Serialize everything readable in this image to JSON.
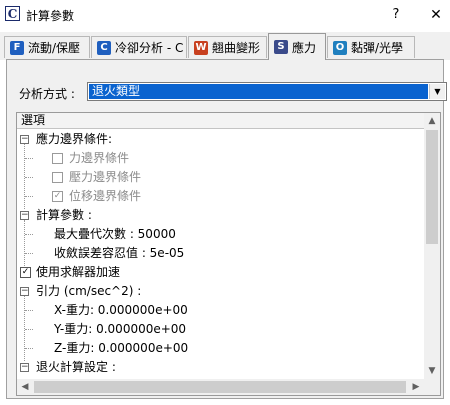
{
  "window": {
    "title": "計算參數",
    "app_icon": "C",
    "help": "?",
    "close": "✕"
  },
  "tabs": [
    {
      "icon": "F",
      "icon_color": "#1f5fbf",
      "label": "流動/保壓",
      "active": false
    },
    {
      "icon": "C",
      "icon_color": "#1f5fbf",
      "label": "冷卻分析 - C",
      "active": false
    },
    {
      "icon": "W",
      "icon_color": "#c8401f",
      "label": "翹曲變形",
      "active": false
    },
    {
      "icon": "S",
      "icon_color": "#3a4a8a",
      "label": "應力",
      "active": true
    },
    {
      "icon": "O",
      "icon_color": "#1f7fbf",
      "label": "黏彈/光學",
      "active": false
    }
  ],
  "method": {
    "label": "分析方式 :",
    "value": "退火類型",
    "arrow": "▼"
  },
  "tree": {
    "header": "選項",
    "rows": [
      {
        "type": "group",
        "expander": "−",
        "text": "應力邊界條件:"
      },
      {
        "type": "checkbox",
        "checked": false,
        "disabled": true,
        "text": "力邊界條件"
      },
      {
        "type": "checkbox",
        "checked": false,
        "disabled": true,
        "text": "壓力邊界條件"
      },
      {
        "type": "checkbox",
        "checked": true,
        "disabled": false,
        "text": "位移邊界條件"
      },
      {
        "type": "group",
        "expander": "−",
        "text": "計算參數 :"
      },
      {
        "type": "value",
        "text": "最大疊代次數 : 50000"
      },
      {
        "type": "value",
        "text": "收斂誤差容忍值 :  5e-05"
      },
      {
        "type": "top-checkbox",
        "checked": true,
        "text": "使用求解器加速"
      },
      {
        "type": "group",
        "expander": "−",
        "text": "引力 (cm/sec^2) :"
      },
      {
        "type": "value",
        "text": "X-重力:  0.000000e+00"
      },
      {
        "type": "value",
        "text": "Y-重力:  0.000000e+00"
      },
      {
        "type": "value",
        "text": "Z-重力:  0.000000e+00"
      },
      {
        "type": "group",
        "expander": "−",
        "text": "退火計算設定 :"
      }
    ]
  },
  "scroll": {
    "up": "▲",
    "down": "▼",
    "left": "◀",
    "right": "▶"
  }
}
